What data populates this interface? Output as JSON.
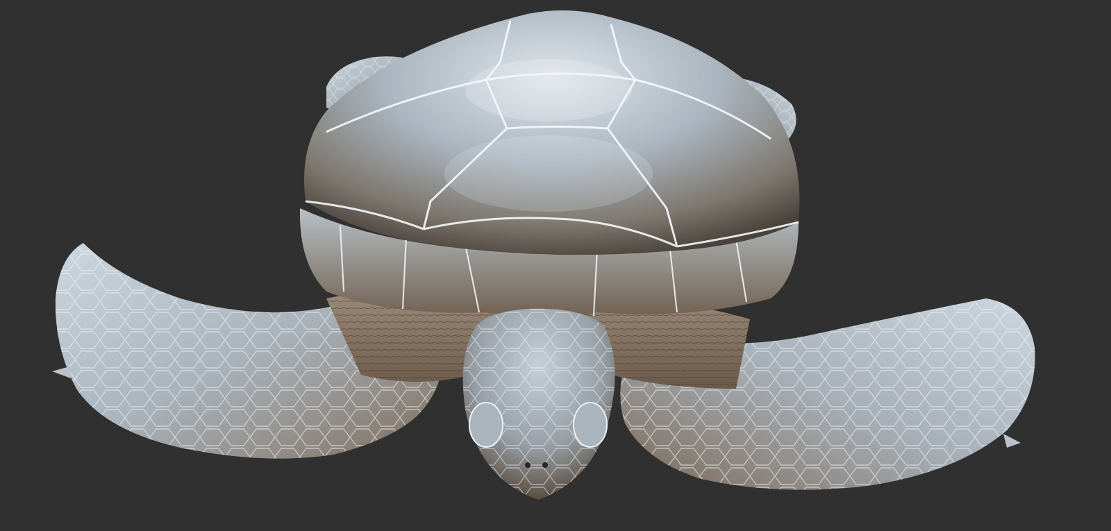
{
  "scene": {
    "subject": "sea-turtle-sculpt",
    "colors": {
      "background": "#303030",
      "shell_light": "#c9d3dc",
      "shell_mid": "#9aa6b1",
      "shell_dark": "#5c5248",
      "bronze": "#8a6a4e",
      "seam": "#f3f6f8"
    }
  }
}
